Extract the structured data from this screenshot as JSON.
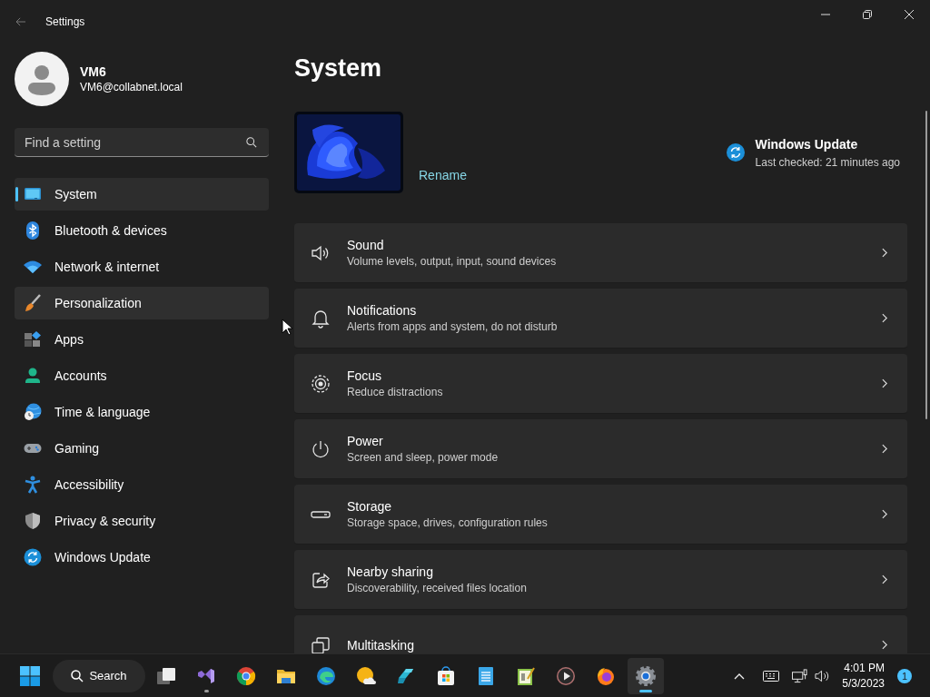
{
  "window": {
    "title": "Settings"
  },
  "account": {
    "name": "VM6",
    "email": "VM6@collabnet.local"
  },
  "search": {
    "placeholder": "Find a setting"
  },
  "nav": [
    {
      "kind": "system",
      "label": "System",
      "selected": true,
      "hovered": false
    },
    {
      "kind": "bluetooth",
      "label": "Bluetooth & devices",
      "selected": false,
      "hovered": false
    },
    {
      "kind": "network",
      "label": "Network & internet",
      "selected": false,
      "hovered": false
    },
    {
      "kind": "personalization",
      "label": "Personalization",
      "selected": false,
      "hovered": true
    },
    {
      "kind": "apps",
      "label": "Apps",
      "selected": false,
      "hovered": false
    },
    {
      "kind": "accounts",
      "label": "Accounts",
      "selected": false,
      "hovered": false
    },
    {
      "kind": "time",
      "label": "Time & language",
      "selected": false,
      "hovered": false
    },
    {
      "kind": "gaming",
      "label": "Gaming",
      "selected": false,
      "hovered": false
    },
    {
      "kind": "accessibility",
      "label": "Accessibility",
      "selected": false,
      "hovered": false
    },
    {
      "kind": "privacy",
      "label": "Privacy & security",
      "selected": false,
      "hovered": false
    },
    {
      "kind": "update",
      "label": "Windows Update",
      "selected": false,
      "hovered": false
    }
  ],
  "page": {
    "title": "System"
  },
  "device": {
    "rename_link": "Rename"
  },
  "update": {
    "title": "Windows Update",
    "status": "Last checked: 21 minutes ago"
  },
  "cards": [
    {
      "kind": "sound",
      "title": "Sound",
      "subtitle": "Volume levels, output, input, sound devices"
    },
    {
      "kind": "notifications",
      "title": "Notifications",
      "subtitle": "Alerts from apps and system, do not disturb"
    },
    {
      "kind": "focus",
      "title": "Focus",
      "subtitle": "Reduce distractions"
    },
    {
      "kind": "power",
      "title": "Power",
      "subtitle": "Screen and sleep, power mode"
    },
    {
      "kind": "storage",
      "title": "Storage",
      "subtitle": "Storage space, drives, configuration rules"
    },
    {
      "kind": "sharing",
      "title": "Nearby sharing",
      "subtitle": "Discoverability, received files location"
    },
    {
      "kind": "multitasking",
      "title": "Multitasking"
    }
  ],
  "taskbar": {
    "search_label": "Search",
    "apps": [
      {
        "kind": "taskview",
        "running": false,
        "active": false
      },
      {
        "kind": "vs",
        "running": true,
        "active": false
      },
      {
        "kind": "chrome",
        "running": false,
        "active": false
      },
      {
        "kind": "explorer",
        "running": false,
        "active": false
      },
      {
        "kind": "edge",
        "running": false,
        "active": false
      },
      {
        "kind": "weather",
        "running": false,
        "active": false
      },
      {
        "kind": "teal",
        "running": false,
        "active": false
      },
      {
        "kind": "store",
        "running": false,
        "active": false
      },
      {
        "kind": "notepad",
        "running": false,
        "active": false
      },
      {
        "kind": "editor",
        "running": false,
        "active": false
      },
      {
        "kind": "media",
        "running": false,
        "active": false
      },
      {
        "kind": "firefox",
        "running": false,
        "active": false
      },
      {
        "kind": "settings",
        "running": true,
        "active": true
      }
    ],
    "time": "4:01 PM",
    "date": "5/3/2023",
    "notification_count": "1"
  }
}
